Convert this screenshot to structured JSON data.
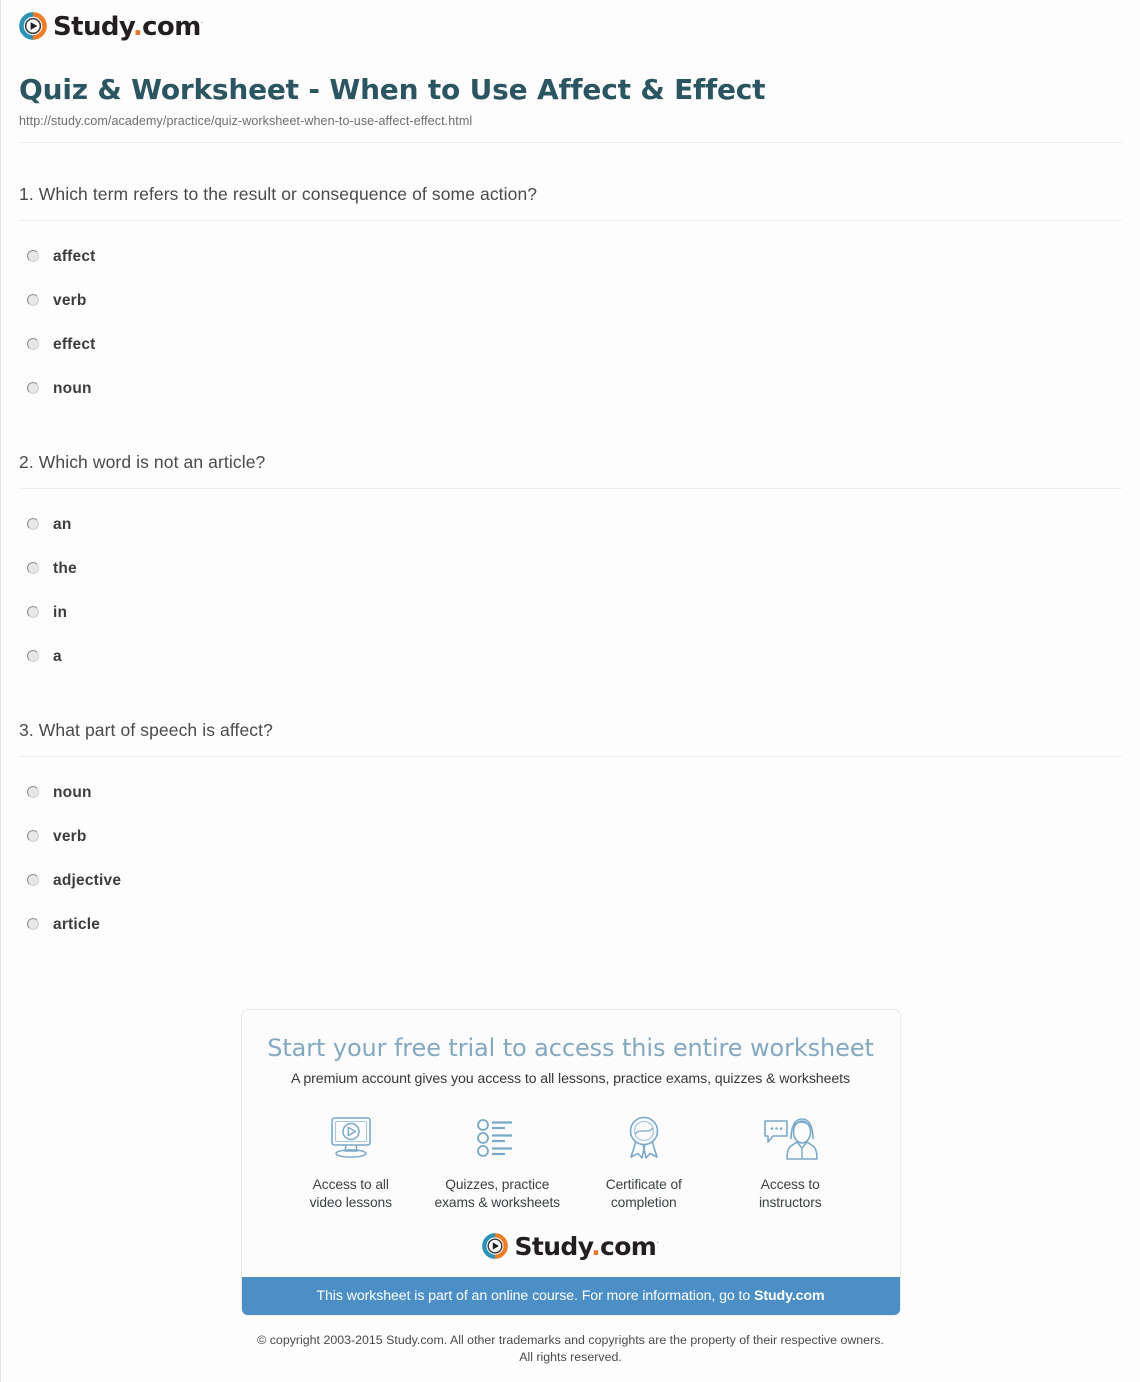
{
  "brand": {
    "name_main": "Study",
    "name_dot": ".",
    "name_tld": "com",
    "trademark": "·",
    "logo_icon": "study-play-circle-icon",
    "colors": {
      "ring_blue": "#2b93b6",
      "ring_orange": "#ef7c27",
      "wordmark": "#231f20",
      "dot_orange": "#e8772e"
    }
  },
  "header": {
    "title": "Quiz & Worksheet - When to Use Affect & Effect",
    "url": "http://study.com/academy/practice/quiz-worksheet-when-to-use-affect-effect.html",
    "title_color": "#2a5561"
  },
  "quiz": {
    "questions": [
      {
        "number": "1.",
        "text": "1. Which term refers to the result or consequence of some action?",
        "options": [
          {
            "label": "affect",
            "selected": false
          },
          {
            "label": "verb",
            "selected": false
          },
          {
            "label": "effect",
            "selected": false
          },
          {
            "label": "noun",
            "selected": false
          }
        ]
      },
      {
        "number": "2.",
        "text": "2. Which word is not an article?",
        "options": [
          {
            "label": "an",
            "selected": false
          },
          {
            "label": "the",
            "selected": false
          },
          {
            "label": "in",
            "selected": false
          },
          {
            "label": "a",
            "selected": false
          }
        ]
      },
      {
        "number": "3.",
        "text": "3. What part of speech is affect?",
        "options": [
          {
            "label": "noun",
            "selected": false
          },
          {
            "label": "verb",
            "selected": false
          },
          {
            "label": "adjective",
            "selected": false
          },
          {
            "label": "article",
            "selected": false
          }
        ]
      }
    ]
  },
  "promo": {
    "title": "Start your free trial to access this entire worksheet",
    "subtitle": "A premium account gives you access to all lessons, practice exams, quizzes & worksheets",
    "title_color": "#83a9c0",
    "features": [
      {
        "icon": "monitor-play-icon",
        "line1": "Access to all",
        "line2": "video lessons"
      },
      {
        "icon": "checklist-icon",
        "line1": "Quizzes, practice",
        "line2": "exams & worksheets"
      },
      {
        "icon": "award-ribbon-icon",
        "line1": "Certificate of",
        "line2": "completion"
      },
      {
        "icon": "instructor-chat-icon",
        "line1": "Access to",
        "line2": "instructors"
      }
    ],
    "banner": {
      "text": "This worksheet is part of an online course. For more information, go to ",
      "link": "Study.com",
      "background": "#4b8fc6"
    }
  },
  "footer": {
    "copyright_line1": "© copyright 2003-2015 Study.com. All other trademarks and copyrights are the property of their respective owners.",
    "copyright_line2": "All rights reserved."
  }
}
